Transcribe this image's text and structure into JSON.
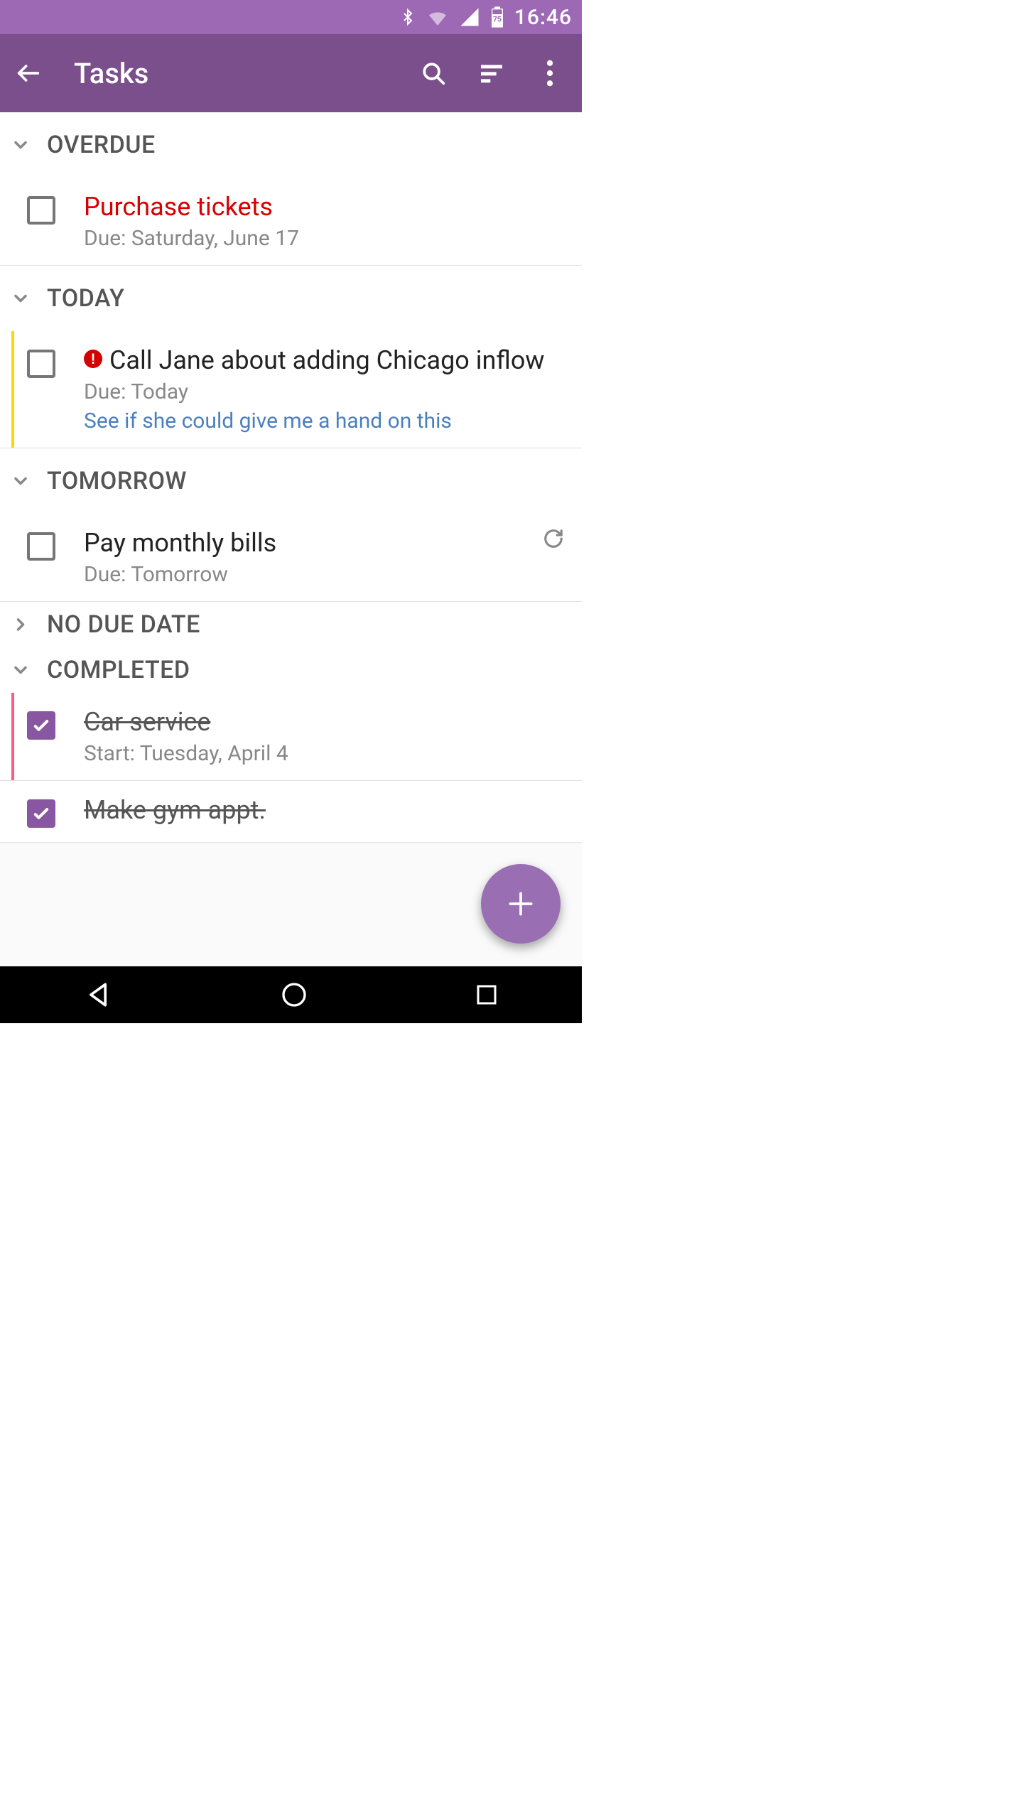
{
  "statusbar": {
    "time": "16:46",
    "battery_text": "75"
  },
  "appbar": {
    "title": "Tasks"
  },
  "sections": {
    "s0": {
      "label": "OVERDUE",
      "expanded": true
    },
    "s1": {
      "label": "TODAY",
      "expanded": true
    },
    "s2": {
      "label": "TOMORROW",
      "expanded": true
    },
    "s3": {
      "label": "NO DUE DATE",
      "expanded": false
    },
    "s4": {
      "label": "COMPLETED",
      "expanded": true
    }
  },
  "tasks": {
    "overdue0": {
      "title": "Purchase tickets",
      "sub": "Due: Saturday, June 17"
    },
    "today0": {
      "title": "Call Jane about adding Chicago inflow",
      "sub": "Due: Today",
      "note": "See if she could give me a hand on this",
      "priority": "high",
      "accent": "yellow"
    },
    "tomorrow0": {
      "title": "Pay monthly bills",
      "sub": "Due: Tomorrow",
      "recurring": true
    },
    "completed0": {
      "title": "Car service",
      "sub": "Start: Tuesday, April 4",
      "accent": "pink"
    },
    "completed1": {
      "title": "Make gym appt."
    }
  },
  "colors": {
    "primary": "#7a4f8b",
    "primaryLight": "#9d69b4",
    "fab": "#9a6eb3"
  }
}
